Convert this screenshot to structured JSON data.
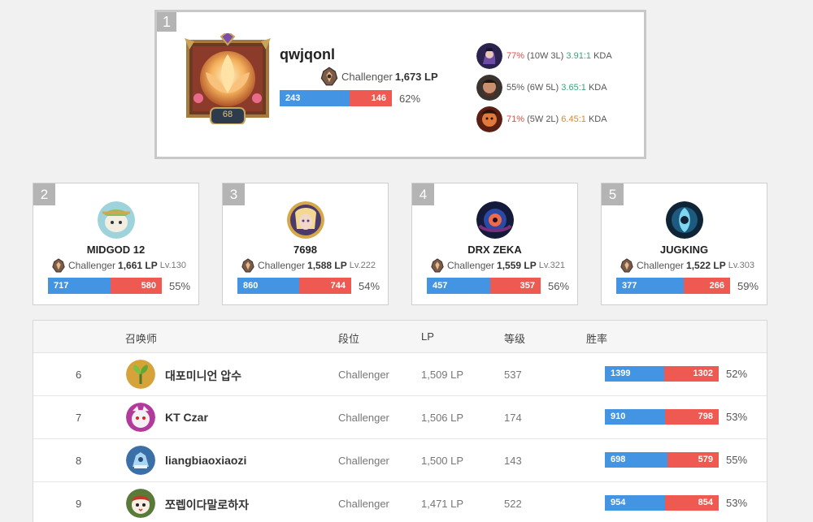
{
  "top": {
    "rank": "1",
    "name": "qwjqonl",
    "level": "68",
    "tier": "Challenger",
    "lp": "1,673 LP",
    "wins": "243",
    "losses": "146",
    "winrate": "62%",
    "win_fraction": 0.62,
    "champions": [
      {
        "winrate": "77%",
        "record": "(10W 3L)",
        "kda": "3.91:1",
        "kda_suffix": "KDA",
        "winrate_color": "red",
        "kda_color": "green"
      },
      {
        "winrate": "55%",
        "record": "(6W 5L)",
        "kda": "3.65:1",
        "kda_suffix": "KDA",
        "winrate_color": "gray",
        "kda_color": "green"
      },
      {
        "winrate": "71%",
        "record": "(5W 2L)",
        "kda": "6.45:1",
        "kda_suffix": "KDA",
        "winrate_color": "red",
        "kda_color": "orange"
      }
    ]
  },
  "runners": [
    {
      "rank": "2",
      "name": "MIDGOD 12",
      "tier": "Challenger",
      "lp": "1,661 LP",
      "level": "Lv.130",
      "wins": "717",
      "losses": "580",
      "winrate": "55%",
      "win_fraction": 0.55
    },
    {
      "rank": "3",
      "name": "7698",
      "tier": "Challenger",
      "lp": "1,588 LP",
      "level": "Lv.222",
      "wins": "860",
      "losses": "744",
      "winrate": "54%",
      "win_fraction": 0.54
    },
    {
      "rank": "4",
      "name": "DRX ZEKA",
      "tier": "Challenger",
      "lp": "1,559 LP",
      "level": "Lv.321",
      "wins": "457",
      "losses": "357",
      "winrate": "56%",
      "win_fraction": 0.56
    },
    {
      "rank": "5",
      "name": "JUGKING",
      "tier": "Challenger",
      "lp": "1,522 LP",
      "level": "Lv.303",
      "wins": "377",
      "losses": "266",
      "winrate": "59%",
      "win_fraction": 0.59
    }
  ],
  "table": {
    "headers": {
      "summoner": "召唤师",
      "tier": "段位",
      "lp": "LP",
      "level": "等级",
      "winrate": "胜率"
    },
    "rows": [
      {
        "rank": "6",
        "name": "대포미니언 압수",
        "tier": "Challenger",
        "lp": "1,509 LP",
        "level": "537",
        "wins": "1399",
        "losses": "1302",
        "winrate": "52%",
        "win_fraction": 0.52
      },
      {
        "rank": "7",
        "name": "KT Czar",
        "tier": "Challenger",
        "lp": "1,506 LP",
        "level": "174",
        "wins": "910",
        "losses": "798",
        "winrate": "53%",
        "win_fraction": 0.53
      },
      {
        "rank": "8",
        "name": "liangbiaoxiaozi",
        "tier": "Challenger",
        "lp": "1,500 LP",
        "level": "143",
        "wins": "698",
        "losses": "579",
        "winrate": "55%",
        "win_fraction": 0.55
      },
      {
        "rank": "9",
        "name": "쪼렙이다말로하자",
        "tier": "Challenger",
        "lp": "1,471 LP",
        "level": "522",
        "wins": "954",
        "losses": "854",
        "winrate": "53%",
        "win_fraction": 0.53
      }
    ]
  },
  "colors": {
    "win": "#4494e4",
    "loss": "#ee5a52",
    "badge": "#b4b4b4"
  }
}
